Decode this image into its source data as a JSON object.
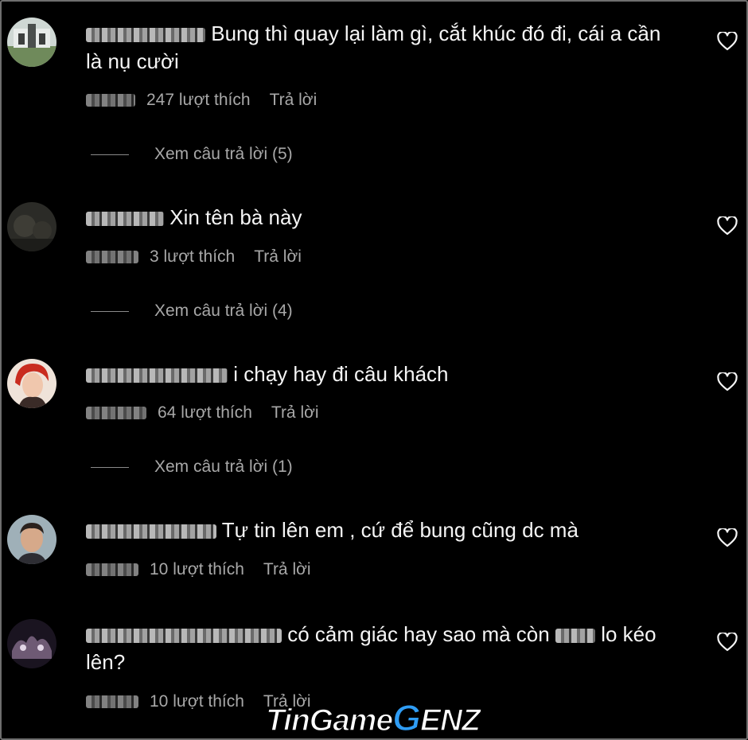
{
  "comments": [
    {
      "text_line1": "Bung thì quay lại làm gì, cắt khúc đó đi, cái a cần",
      "text_line2": "là nụ cười",
      "likes": "247 lượt thích",
      "reply": "Trả lời",
      "view_replies": "Xem câu trả lời (5)"
    },
    {
      "text_line1": "Xin tên bà này",
      "likes": "3 lượt thích",
      "reply": "Trả lời",
      "view_replies": "Xem câu trả lời (4)"
    },
    {
      "text_line1": "i chạy hay đi câu khách",
      "likes": "64 lượt thích",
      "reply": "Trả lời",
      "view_replies": "Xem câu trả lời (1)"
    },
    {
      "text_line1": "Tự tin lên em , cứ để bung cũng dc mà",
      "likes": "10 lượt thích",
      "reply": "Trả lời"
    },
    {
      "text_line1_a": "có cảm giác hay sao mà còn",
      "text_line1_b": "lo kéo",
      "text_line2": "lên?",
      "likes": "10 lượt thích",
      "reply": "Trả lời"
    }
  ],
  "watermark": {
    "part1": "TinGame",
    "part2": "G",
    "part3": "ENZ"
  },
  "icons": {
    "like": "heart-outline-icon"
  },
  "colors": {
    "background": "#000000",
    "text": "#f5f5f5",
    "meta": "#a8a8a8",
    "watermark_accent": "#2f9df5"
  }
}
